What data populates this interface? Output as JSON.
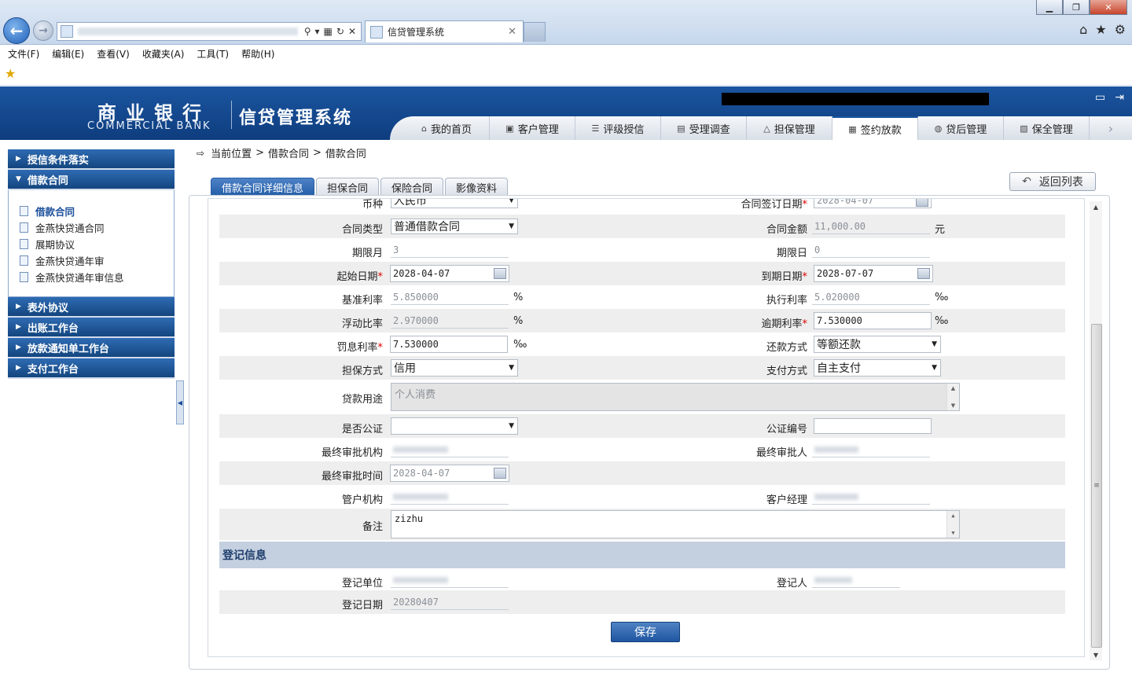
{
  "browser": {
    "tab_title": "信贷管理系统",
    "menu": [
      "文件(F)",
      "编辑(E)",
      "查看(V)",
      "收藏夹(A)",
      "工具(T)",
      "帮助(H)"
    ]
  },
  "header": {
    "logo_cn": "商业银行",
    "logo_en": "COMMERCIAL BANK",
    "system_name": "信贷管理系统",
    "nav": [
      {
        "label": "我的首页",
        "icon": "home-icon"
      },
      {
        "label": "客户管理",
        "icon": "customer-icon"
      },
      {
        "label": "评级授信",
        "icon": "rating-icon"
      },
      {
        "label": "受理调查",
        "icon": "survey-icon"
      },
      {
        "label": "担保管理",
        "icon": "guarantee-icon"
      },
      {
        "label": "签约放款",
        "icon": "contract-icon"
      },
      {
        "label": "贷后管理",
        "icon": "postloan-icon"
      },
      {
        "label": "保全管理",
        "icon": "preserve-icon"
      }
    ],
    "active_nav": "签约放款"
  },
  "sidebar": {
    "groups": [
      {
        "label": "授信条件落实",
        "expanded": false
      },
      {
        "label": "借款合同",
        "expanded": true
      },
      {
        "label": "表外协议",
        "expanded": false
      },
      {
        "label": "出账工作台",
        "expanded": false
      },
      {
        "label": "放款通知单工作台",
        "expanded": false
      },
      {
        "label": "支付工作台",
        "expanded": false
      }
    ],
    "sub_items": [
      "借款合同",
      "金燕快贷通合同",
      "展期协议",
      "金燕快贷通年审",
      "金燕快贷通年审信息"
    ],
    "active_sub_item": "借款合同"
  },
  "breadcrumb": {
    "label": "当前位置",
    "items": [
      "借款合同",
      "借款合同"
    ],
    "separator": ">"
  },
  "tabs": [
    "借款合同详细信息",
    "担保合同",
    "保险合同",
    "影像资料"
  ],
  "active_tab": "借款合同详细信息",
  "back_button": "返回列表",
  "form": {
    "currency_label": "币种",
    "currency_value": "人民币",
    "sign_date_label": "合同签订日期",
    "sign_date_value": "2028-04-07",
    "contract_type_label": "合同类型",
    "contract_type_value": "普通借款合同",
    "contract_amount_label": "合同金额",
    "contract_amount_value": "11,000.00",
    "contract_amount_unit": "元",
    "term_month_label": "期限月",
    "term_month_value": "3",
    "term_day_label": "期限日",
    "term_day_value": "0",
    "start_date_label": "起始日期",
    "start_date_value": "2028-04-07",
    "end_date_label": "到期日期",
    "end_date_value": "2028-07-07",
    "base_rate_label": "基准利率",
    "base_rate_value": "5.850000",
    "base_rate_unit": "%",
    "exec_rate_label": "执行利率",
    "exec_rate_value": "5.020000",
    "exec_rate_unit": "‰",
    "float_ratio_label": "浮动比率",
    "float_ratio_value": "2.970000",
    "float_ratio_unit": "%",
    "overdue_rate_label": "逾期利率",
    "overdue_rate_value": "7.530000",
    "overdue_rate_unit": "‰",
    "penalty_rate_label": "罚息利率",
    "penalty_rate_value": "7.530000",
    "penalty_rate_unit": "‰",
    "repay_method_label": "还款方式",
    "repay_method_value": "等额还款",
    "guarantee_method_label": "担保方式",
    "guarantee_method_value": "信用",
    "payment_method_label": "支付方式",
    "payment_method_value": "自主支付",
    "purpose_label": "贷款用途",
    "purpose_value": "个人消费",
    "notarized_label": "是否公证",
    "notarized_value": "",
    "notary_no_label": "公证编号",
    "notary_no_value": "",
    "approve_org_label": "最终审批机构",
    "approver_label": "最终审批人",
    "approve_time_label": "最终审批时间",
    "approve_time_value": "2028-04-07",
    "manage_org_label": "管户机构",
    "manager_label": "客户经理",
    "remark_label": "备注",
    "remark_value": "zizhu"
  },
  "registration": {
    "title": "登记信息",
    "unit_label": "登记单位",
    "person_label": "登记人",
    "date_label": "登记日期",
    "date_value": "20280407"
  },
  "save_button": "保存"
}
